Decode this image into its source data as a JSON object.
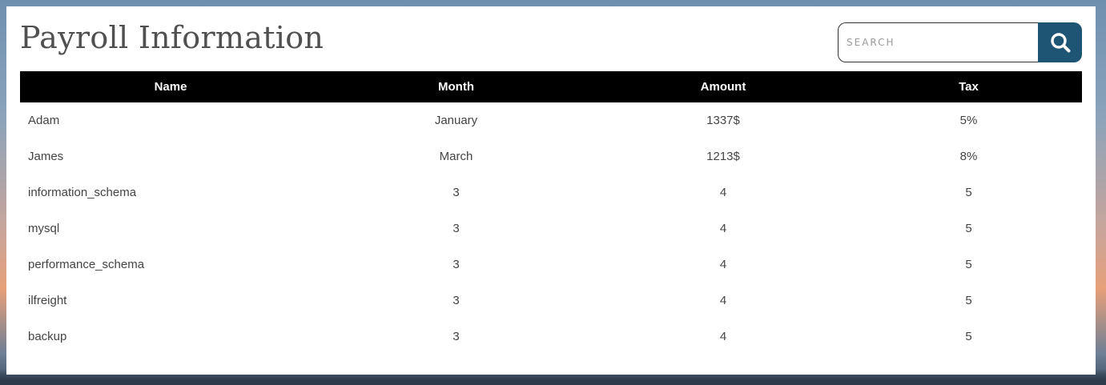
{
  "page": {
    "title": "Payroll Information"
  },
  "search": {
    "placeholder": "SEARCH",
    "icon": "search-icon",
    "button_color": "#1e5474"
  },
  "table": {
    "headers": [
      "Name",
      "Month",
      "Amount",
      "Tax"
    ],
    "rows": [
      [
        "Adam",
        "January",
        "1337$",
        "5%"
      ],
      [
        "James",
        "March",
        "1213$",
        "8%"
      ],
      [
        "information_schema",
        "3",
        "4",
        "5"
      ],
      [
        "mysql",
        "3",
        "4",
        "5"
      ],
      [
        "performance_schema",
        "3",
        "4",
        "5"
      ],
      [
        "ilfreight",
        "3",
        "4",
        "5"
      ],
      [
        "backup",
        "3",
        "4",
        "5"
      ]
    ]
  }
}
